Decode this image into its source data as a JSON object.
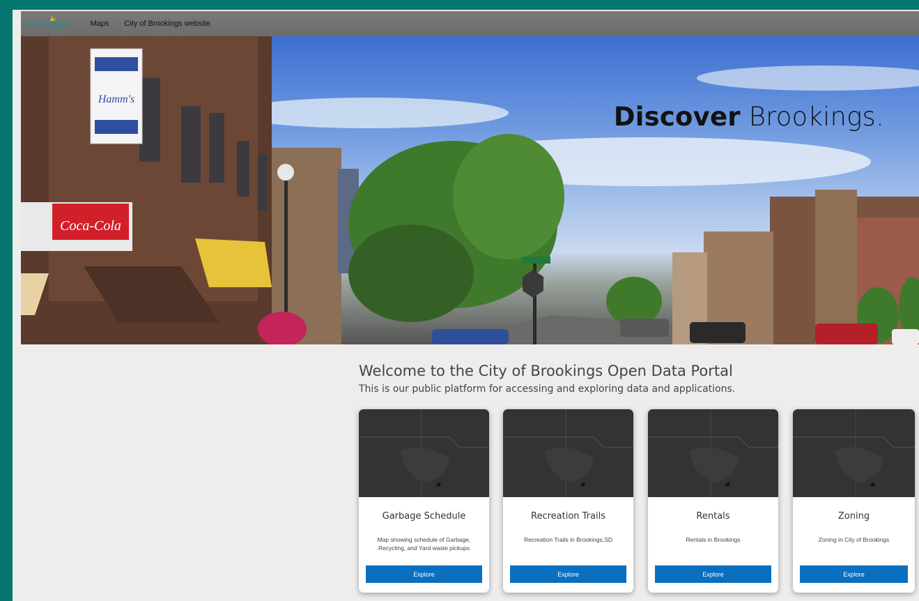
{
  "nav": {
    "logo_text": "brookings",
    "links": [
      "Maps",
      "City of Brookings website"
    ]
  },
  "hero": {
    "title_bold": "Discover",
    "title_rest": " Brookings."
  },
  "welcome": {
    "heading": "Welcome to the City of Brookings Open Data Portal",
    "subheading": "This is our public platform for accessing and exploring data and applications."
  },
  "cards": [
    {
      "title": "Garbage Schedule",
      "desc": "Map showing schedule of Garbage, Recycling, and Yard waste pickups",
      "button": "Explore"
    },
    {
      "title": "Recreation Trails",
      "desc": "Recreation Trails in Brookings,SD",
      "button": "Explore"
    },
    {
      "title": "Rentals",
      "desc": "Rentals in Brookings",
      "button": "Explore"
    },
    {
      "title": "Zoning",
      "desc": "Zoning in City of Brookings",
      "button": "Explore"
    }
  ],
  "colors": {
    "frame": "#04766e",
    "button": "#0a6fbf",
    "nav_bg": "#737373"
  }
}
